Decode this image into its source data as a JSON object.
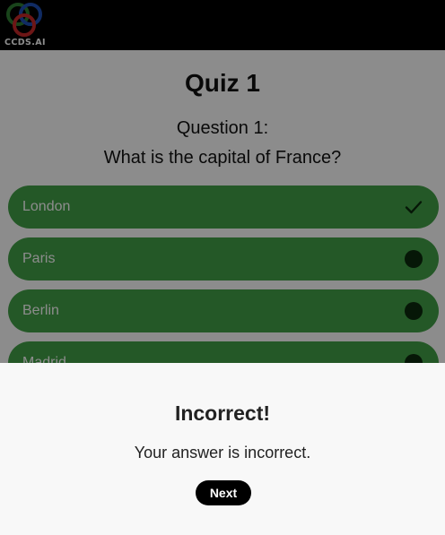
{
  "app_bar": {
    "logo_text": "CCDS.AI"
  },
  "quiz": {
    "title": "Quiz 1",
    "question_number": "Question 1:",
    "question_text": "What is the capital of France?",
    "options": [
      {
        "label": "London",
        "marker": "check-icon"
      },
      {
        "label": "Paris",
        "marker": "dot-icon"
      },
      {
        "label": "Berlin",
        "marker": "dot-icon"
      },
      {
        "label": "Madrid",
        "marker": "dot-icon"
      }
    ]
  },
  "result": {
    "title": "Incorrect!",
    "message": "Your answer is incorrect.",
    "next_label": "Next"
  },
  "colors": {
    "option_bg": "#43a047",
    "app_bar": "#000000",
    "sheet_bg": "#f8f8f8"
  }
}
